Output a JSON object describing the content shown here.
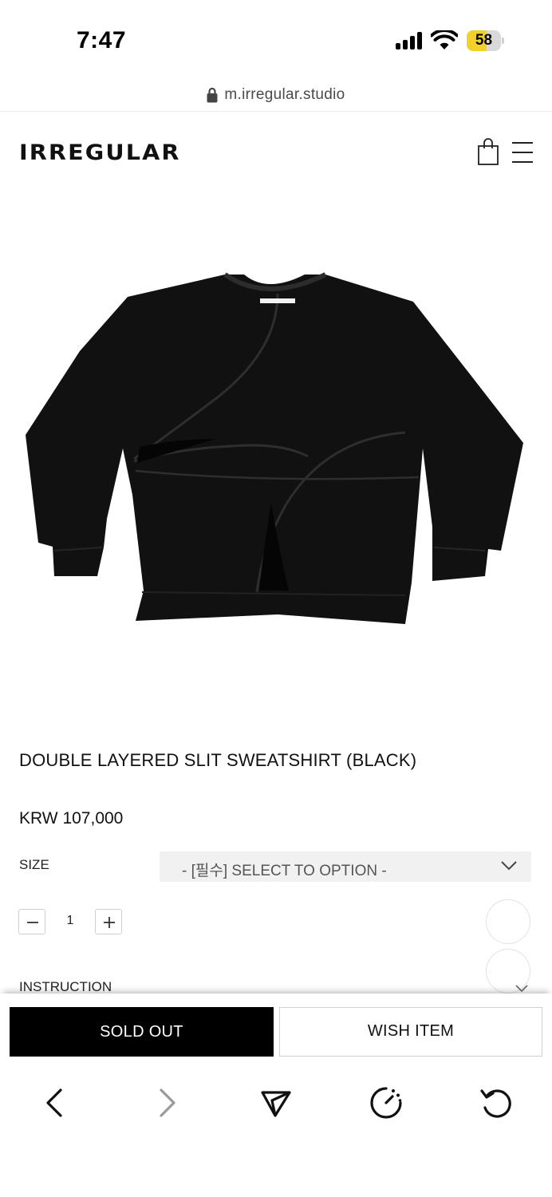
{
  "status_bar": {
    "time": "7:47",
    "battery": "58",
    "battery_level": 0.58,
    "battery_color": "#f3d12b"
  },
  "browser": {
    "url": "m.irregular.studio"
  },
  "header": {
    "logo": "IRREGULAR",
    "icons": [
      "shopping-bag-icon",
      "hamburger-menu-icon"
    ]
  },
  "product": {
    "title": "DOUBLE LAYERED SLIT SWEATSHIRT (BLACK)",
    "price": "KRW 107,000",
    "size_label": "SIZE",
    "size_select_value": "- [필수] SELECT TO OPTION -",
    "quantity": "1",
    "instruction_label": "INSTRUCTION"
  },
  "actions": {
    "sold_out_label": "SOLD OUT",
    "wish_label": "WISH ITEM",
    "sold_out_bg": "#000000"
  },
  "toolbar": {
    "icons": [
      "back-icon",
      "forward-icon",
      "share-icon",
      "tabs-icon",
      "reload-icon"
    ]
  }
}
